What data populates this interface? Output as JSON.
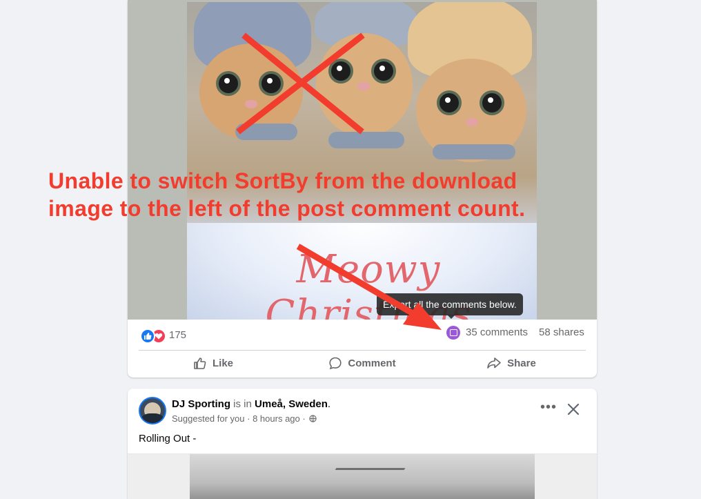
{
  "post1": {
    "image_caption": "Meowy Christmas",
    "tooltip": "Export all the comments below.",
    "reaction_count": "175",
    "comments": "35 comments",
    "shares": "58 shares",
    "actions": {
      "like": "Like",
      "comment": "Comment",
      "share": "Share"
    }
  },
  "annotation": {
    "line1": "Unable to switch SortBy from the download",
    "line2": "image to the left of the post comment count.",
    "color": "#f23c2e"
  },
  "post2": {
    "author": "DJ Sporting",
    "is_in": "is in",
    "location": "Umeå, Sweden",
    "suffix": ".",
    "suggested": "Suggested for you",
    "time": "8 hours ago",
    "text": "Rolling Out -"
  },
  "colors": {
    "accent": "#1877f2",
    "love": "#f33e58",
    "extension": "#9b59d9"
  },
  "icons": [
    "thumbs-up-icon",
    "heart-icon",
    "export-extension-icon",
    "like-icon",
    "comment-icon",
    "share-icon",
    "globe-icon",
    "more-icon",
    "close-icon"
  ]
}
